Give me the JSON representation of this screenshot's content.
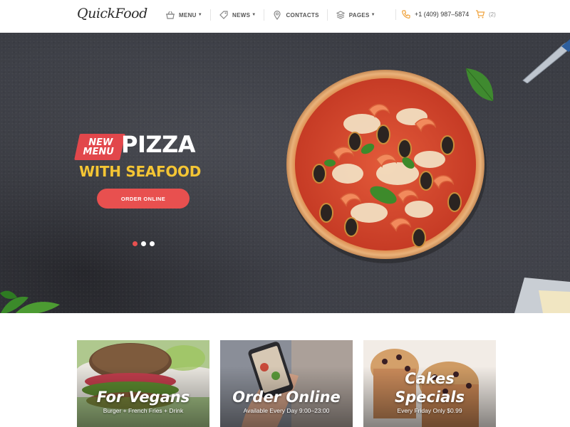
{
  "header": {
    "logo": "QuickFood",
    "nav": [
      {
        "label": "MENU",
        "icon": "basket-icon",
        "dropdown": true
      },
      {
        "label": "NEWS",
        "icon": "tag-icon",
        "dropdown": true
      },
      {
        "label": "CONTACTS",
        "icon": "map-pin-icon",
        "dropdown": false
      },
      {
        "label": "PAGES",
        "icon": "layers-icon",
        "dropdown": true
      }
    ],
    "phone": "+1 (409) 987–5874",
    "cart_count": "(2)"
  },
  "hero": {
    "badge_line1": "NEW",
    "badge_line2": "MENU",
    "title": "PIZZA",
    "subtitle": "WITH SEAFOOD",
    "cta": "ORDER ONLINE",
    "slides": 3,
    "active_slide": 1
  },
  "cards": [
    {
      "title": "For Vegans",
      "subtitle": "Burger + French Fries + Drink"
    },
    {
      "title": "Order Online",
      "subtitle": "Available Every Day 9:00–23:00"
    },
    {
      "title_line1": "Cakes",
      "title_line2": "Specials",
      "subtitle": "Every Friday Only $0.99"
    }
  ],
  "colors": {
    "accent": "#e8504f",
    "yellow": "#f4c534",
    "hero_bg": "#3b3d44",
    "phone_icon": "#f0a23b"
  }
}
